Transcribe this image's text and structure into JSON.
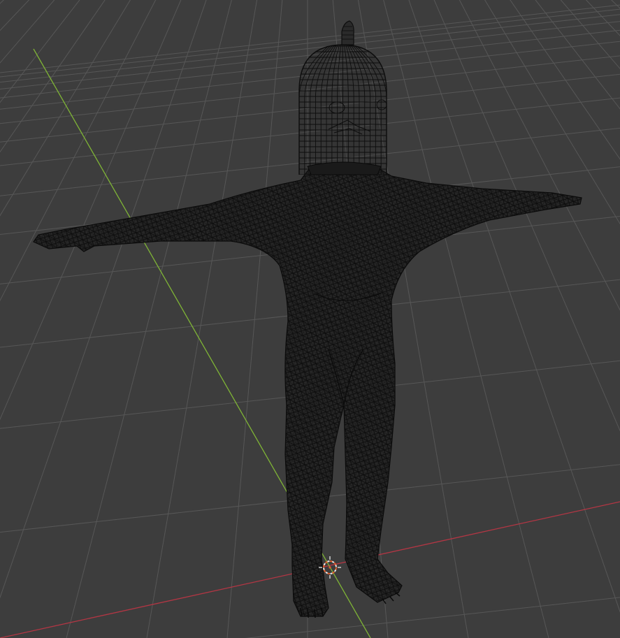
{
  "viewport": {
    "mode": "wireframe",
    "background_color": "#3d3d3d",
    "grid_color": "#575757",
    "grid_fine_color": "#4a4a4a",
    "x_axis_color": "#b33644",
    "y_axis_color": "#7fb436",
    "wire_color": "#0d0d0d",
    "wire_fill_color": "#262626",
    "origin_color": "#e8e8e8",
    "origin_accent_color": "#e15a28"
  },
  "scene": {
    "object": "humanoid-mesh",
    "pose": "t-pose",
    "head": "cage-dome"
  }
}
